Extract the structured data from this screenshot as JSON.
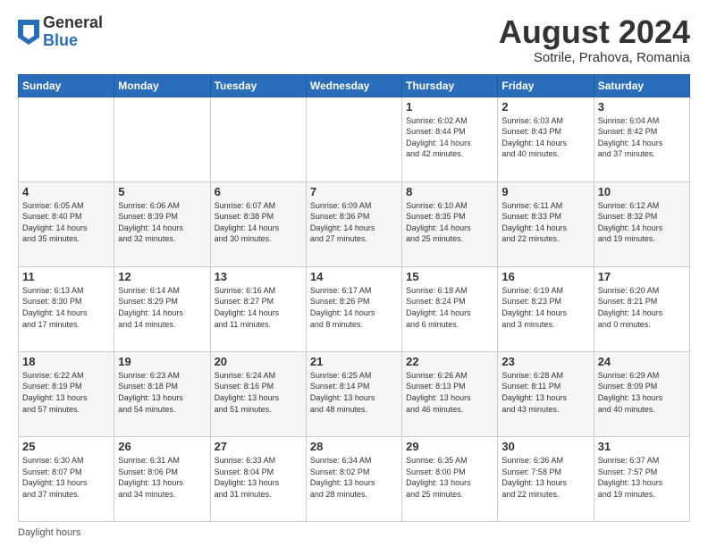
{
  "header": {
    "logo": {
      "general": "General",
      "blue": "Blue"
    },
    "title": "August 2024",
    "subtitle": "Sotrile, Prahova, Romania"
  },
  "weekdays": [
    "Sunday",
    "Monday",
    "Tuesday",
    "Wednesday",
    "Thursday",
    "Friday",
    "Saturday"
  ],
  "weeks": [
    [
      {
        "day": "",
        "info": ""
      },
      {
        "day": "",
        "info": ""
      },
      {
        "day": "",
        "info": ""
      },
      {
        "day": "",
        "info": ""
      },
      {
        "day": "1",
        "info": "Sunrise: 6:02 AM\nSunset: 8:44 PM\nDaylight: 14 hours\nand 42 minutes."
      },
      {
        "day": "2",
        "info": "Sunrise: 6:03 AM\nSunset: 8:43 PM\nDaylight: 14 hours\nand 40 minutes."
      },
      {
        "day": "3",
        "info": "Sunrise: 6:04 AM\nSunset: 8:42 PM\nDaylight: 14 hours\nand 37 minutes."
      }
    ],
    [
      {
        "day": "4",
        "info": "Sunrise: 6:05 AM\nSunset: 8:40 PM\nDaylight: 14 hours\nand 35 minutes."
      },
      {
        "day": "5",
        "info": "Sunrise: 6:06 AM\nSunset: 8:39 PM\nDaylight: 14 hours\nand 32 minutes."
      },
      {
        "day": "6",
        "info": "Sunrise: 6:07 AM\nSunset: 8:38 PM\nDaylight: 14 hours\nand 30 minutes."
      },
      {
        "day": "7",
        "info": "Sunrise: 6:09 AM\nSunset: 8:36 PM\nDaylight: 14 hours\nand 27 minutes."
      },
      {
        "day": "8",
        "info": "Sunrise: 6:10 AM\nSunset: 8:35 PM\nDaylight: 14 hours\nand 25 minutes."
      },
      {
        "day": "9",
        "info": "Sunrise: 6:11 AM\nSunset: 8:33 PM\nDaylight: 14 hours\nand 22 minutes."
      },
      {
        "day": "10",
        "info": "Sunrise: 6:12 AM\nSunset: 8:32 PM\nDaylight: 14 hours\nand 19 minutes."
      }
    ],
    [
      {
        "day": "11",
        "info": "Sunrise: 6:13 AM\nSunset: 8:30 PM\nDaylight: 14 hours\nand 17 minutes."
      },
      {
        "day": "12",
        "info": "Sunrise: 6:14 AM\nSunset: 8:29 PM\nDaylight: 14 hours\nand 14 minutes."
      },
      {
        "day": "13",
        "info": "Sunrise: 6:16 AM\nSunset: 8:27 PM\nDaylight: 14 hours\nand 11 minutes."
      },
      {
        "day": "14",
        "info": "Sunrise: 6:17 AM\nSunset: 8:26 PM\nDaylight: 14 hours\nand 8 minutes."
      },
      {
        "day": "15",
        "info": "Sunrise: 6:18 AM\nSunset: 8:24 PM\nDaylight: 14 hours\nand 6 minutes."
      },
      {
        "day": "16",
        "info": "Sunrise: 6:19 AM\nSunset: 8:23 PM\nDaylight: 14 hours\nand 3 minutes."
      },
      {
        "day": "17",
        "info": "Sunrise: 6:20 AM\nSunset: 8:21 PM\nDaylight: 14 hours\nand 0 minutes."
      }
    ],
    [
      {
        "day": "18",
        "info": "Sunrise: 6:22 AM\nSunset: 8:19 PM\nDaylight: 13 hours\nand 57 minutes."
      },
      {
        "day": "19",
        "info": "Sunrise: 6:23 AM\nSunset: 8:18 PM\nDaylight: 13 hours\nand 54 minutes."
      },
      {
        "day": "20",
        "info": "Sunrise: 6:24 AM\nSunset: 8:16 PM\nDaylight: 13 hours\nand 51 minutes."
      },
      {
        "day": "21",
        "info": "Sunrise: 6:25 AM\nSunset: 8:14 PM\nDaylight: 13 hours\nand 48 minutes."
      },
      {
        "day": "22",
        "info": "Sunrise: 6:26 AM\nSunset: 8:13 PM\nDaylight: 13 hours\nand 46 minutes."
      },
      {
        "day": "23",
        "info": "Sunrise: 6:28 AM\nSunset: 8:11 PM\nDaylight: 13 hours\nand 43 minutes."
      },
      {
        "day": "24",
        "info": "Sunrise: 6:29 AM\nSunset: 8:09 PM\nDaylight: 13 hours\nand 40 minutes."
      }
    ],
    [
      {
        "day": "25",
        "info": "Sunrise: 6:30 AM\nSunset: 8:07 PM\nDaylight: 13 hours\nand 37 minutes."
      },
      {
        "day": "26",
        "info": "Sunrise: 6:31 AM\nSunset: 8:06 PM\nDaylight: 13 hours\nand 34 minutes."
      },
      {
        "day": "27",
        "info": "Sunrise: 6:33 AM\nSunset: 8:04 PM\nDaylight: 13 hours\nand 31 minutes."
      },
      {
        "day": "28",
        "info": "Sunrise: 6:34 AM\nSunset: 8:02 PM\nDaylight: 13 hours\nand 28 minutes."
      },
      {
        "day": "29",
        "info": "Sunrise: 6:35 AM\nSunset: 8:00 PM\nDaylight: 13 hours\nand 25 minutes."
      },
      {
        "day": "30",
        "info": "Sunrise: 6:36 AM\nSunset: 7:58 PM\nDaylight: 13 hours\nand 22 minutes."
      },
      {
        "day": "31",
        "info": "Sunrise: 6:37 AM\nSunset: 7:57 PM\nDaylight: 13 hours\nand 19 minutes."
      }
    ]
  ],
  "footer": {
    "label": "Daylight hours"
  }
}
